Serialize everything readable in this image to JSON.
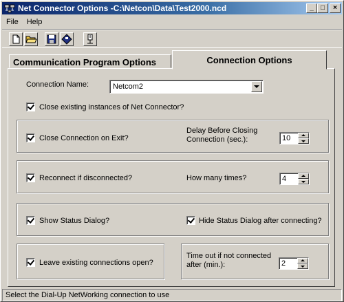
{
  "window": {
    "title": "Net Connector Options -C:\\Netcon\\Data\\Test2000.ncd",
    "minimize_glyph": "_",
    "maximize_glyph": "□",
    "close_glyph": "×"
  },
  "menu": {
    "items": [
      "File",
      "Help"
    ]
  },
  "toolbar": {
    "icons": [
      "new-file-icon",
      "open-folder-icon",
      "save-icon",
      "save-as-icon",
      "connection-icon"
    ]
  },
  "tabs": {
    "communication": "Communication Program Options",
    "connection": "Connection Options"
  },
  "form": {
    "connection_name_label": "Connection Name:",
    "connection_name_value": "Netcom2",
    "close_existing_label": "Close existing instances of Net Connector?",
    "close_on_exit_label": "Close Connection on Exit?",
    "delay_label_line1": "Delay Before Closing",
    "delay_label_line2": "Connection (sec.):",
    "delay_value": "10",
    "reconnect_label": "Reconnect if disconnected?",
    "how_many_label": "How many times?",
    "how_many_value": "4",
    "show_status_label": "Show Status Dialog?",
    "hide_status_label": "Hide Status Dialog after connecting?",
    "leave_open_label": "Leave existing connections open?",
    "timeout_label_line1": "Time out if not connected",
    "timeout_label_line2": "after (min.):",
    "timeout_value": "2"
  },
  "statusbar": {
    "text": "Select the Dial-Up NetWorking connection to use"
  }
}
